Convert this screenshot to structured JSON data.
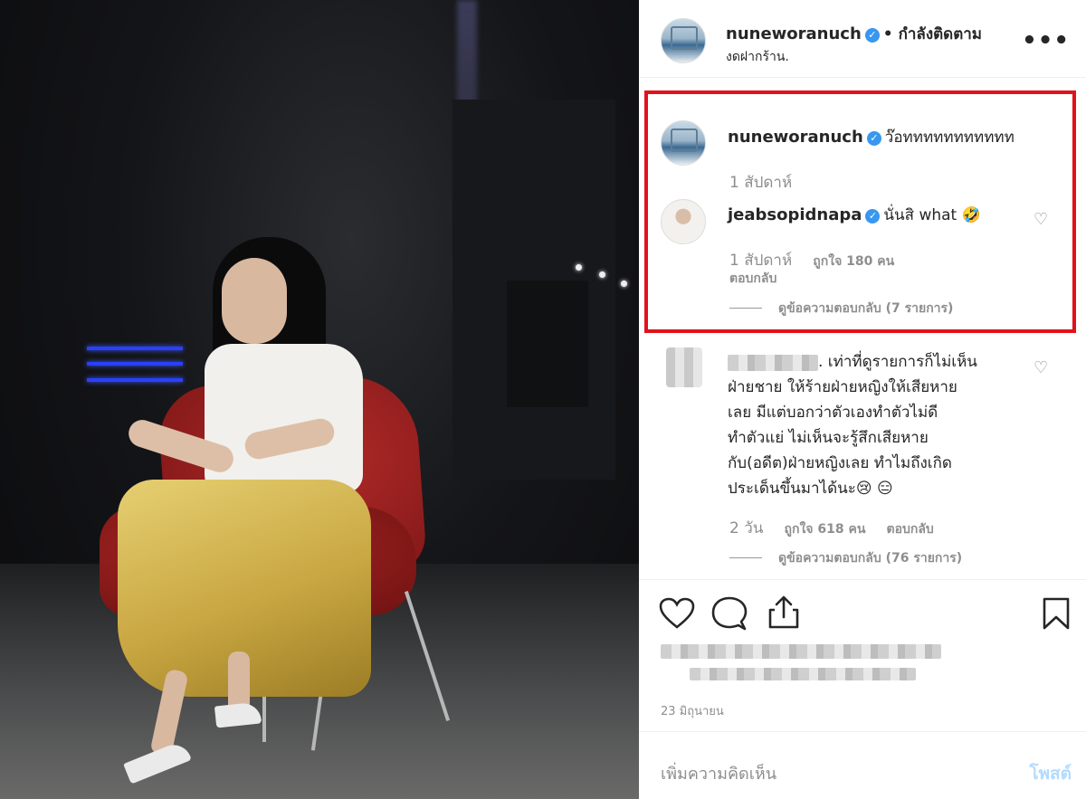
{
  "header": {
    "username": "nuneworanuch",
    "follow_status": "• กำลังติดตาม",
    "location": "งดฝากร้าน.",
    "more_icon": "more-options-icon"
  },
  "comments": [
    {
      "username": "nuneworanuch",
      "text": "ว๊อททททททททททท",
      "time": "1 สัปดาห์"
    },
    {
      "username": "jeabsopidnapa",
      "text": "นั่นสิ what 🤣",
      "time": "1 สัปดาห์",
      "likes": "ถูกใจ 180 คน",
      "reply": "ตอบกลับ",
      "view_replies": "ดูข้อความตอบกลับ (7 รายการ)"
    },
    {
      "username": "",
      "text_lines": [
        ". เท่าที่ดูรายการก็ไม่เห็น",
        "ฝ่ายชาย ให้ร้ายฝ่ายหญิงให้เสียหาย",
        "เลย มีแต่บอกว่าตัวเองทำตัวไม่ดี",
        "ทำตัวแย่ ไม่เห็นจะรู้สึกเสียหาย",
        "กับ(อดีต)ฝ่ายหญิงเลย ทำไมถึงเกิด",
        "ประเด็นขึ้นมาได้นะ😢 😑"
      ],
      "time": "2 วัน",
      "likes": "ถูกใจ 618 คน",
      "reply": "ตอบกลับ",
      "view_replies": "ดูข้อความตอบกลับ (76 รายการ)"
    }
  ],
  "post": {
    "date": "23 มิถุนายน",
    "comment_placeholder": "เพิ่มความคิดเห็น",
    "post_button": "โพสต์"
  },
  "colors": {
    "highlight_box": "#e1121b",
    "verified": "#3897f0",
    "post_button_disabled": "#b3dbff"
  }
}
